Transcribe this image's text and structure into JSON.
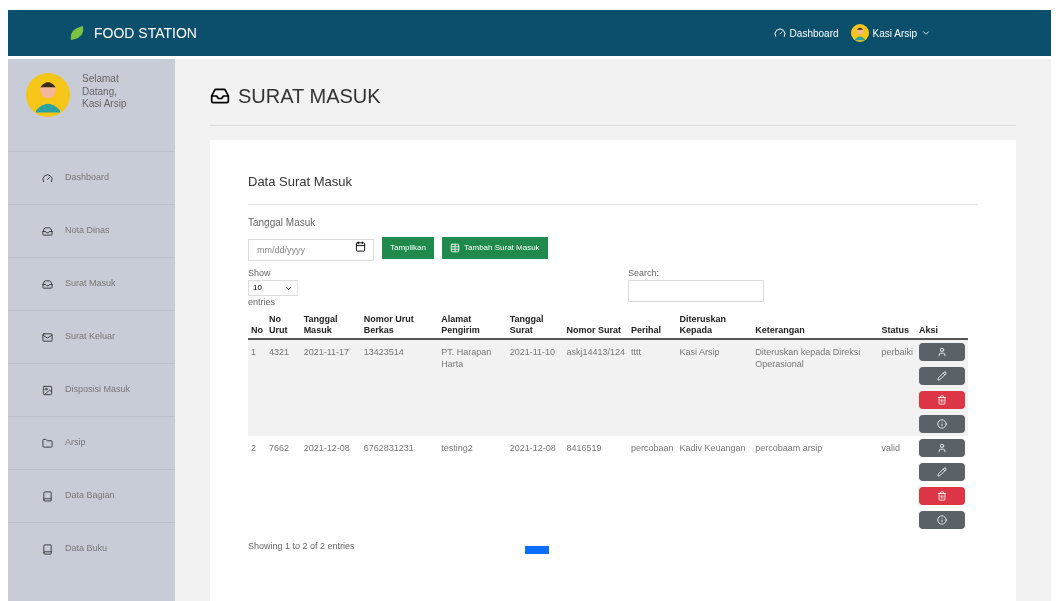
{
  "navbar": {
    "brand": "FOOD STATION",
    "links": [
      {
        "label": "Dashboard"
      }
    ],
    "user": "Kasi Arsip"
  },
  "sidebar": {
    "greeting": "Selamat Datang, Kasi Arsip",
    "items": [
      {
        "label": "Dashboard",
        "selected": false
      },
      {
        "label": "Nota Dinas",
        "selected": false
      },
      {
        "label": "Surat Masuk",
        "selected": false
      },
      {
        "label": "Surat Keluar",
        "selected": false
      },
      {
        "label": "Disposisi Masuk",
        "selected": false
      },
      {
        "label": "Arsip",
        "selected": false
      },
      {
        "label": "Data Bagian",
        "selected": false
      },
      {
        "label": "Data Buku",
        "selected": false
      }
    ]
  },
  "page_title": "SURAT MASUK",
  "card": {
    "title": "Data Surat Masuk",
    "date_label": "Tanggal Masuk",
    "date_placeholder": "mm/dd/yyyy",
    "show_button": "Tampilkan",
    "add_button": "Tambah Surat Masuk",
    "show_label": "Show",
    "page_size": "10",
    "entries_label": "entries",
    "search_label": "Search:"
  },
  "table": {
    "columns": [
      "No",
      "No Urut",
      "Tanggal Masuk",
      "Nomor Urut Berkas",
      "Alamat Pengirim",
      "Tanggal Surat",
      "Nomor Surat",
      "Perihal",
      "Diteruskan Kepada",
      "Keterangan",
      "Status",
      "Aksi"
    ],
    "rows": [
      {
        "cells": [
          "1",
          "4321",
          "2021-11-17",
          "13423514",
          "PT. Harapan Harta",
          "2021-11-10",
          "askj14413/124",
          "tttt",
          "Kasi Arsip",
          "Diteruskan kepada Direksi Operasional",
          "perbaiki"
        ]
      },
      {
        "cells": [
          "2",
          "7662",
          "2021-12-08",
          "6762831231",
          "testing2",
          "2021-12-08",
          "8416519",
          "percobaan",
          "Kadiv Keuangan",
          "percobaam arsip",
          "valid"
        ]
      }
    ]
  },
  "footer_info": "Showing 1 to 2 of 2 entries"
}
